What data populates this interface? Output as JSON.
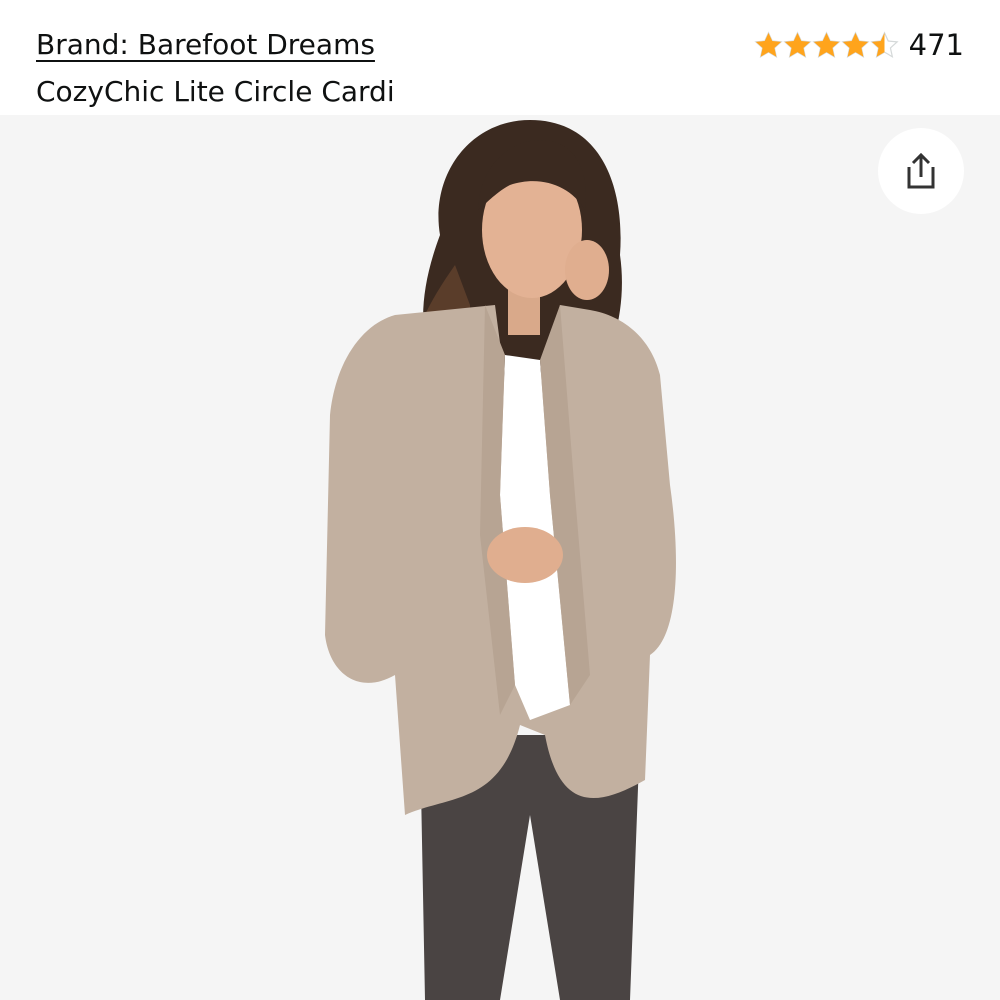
{
  "header": {
    "brand_label": "Brand: Barefoot Dreams",
    "product_title": "CozyChic Lite Circle Cardi"
  },
  "rating": {
    "stars_value": 4.5,
    "stars_max": 5,
    "count": "471",
    "star_color": "#ffa41c"
  },
  "image": {
    "share_icon": "share-icon",
    "background_color": "#f5f5f5"
  }
}
